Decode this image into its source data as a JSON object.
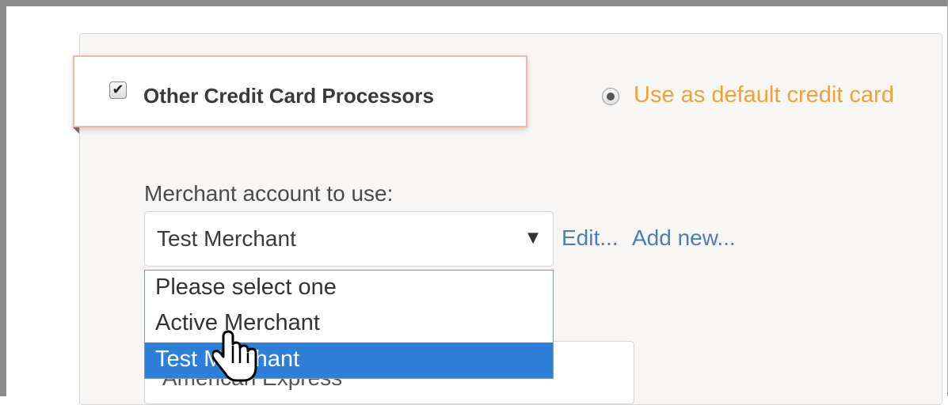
{
  "section": {
    "checkbox_checked": true,
    "checkbox_glyph": "✔",
    "title": "Other Credit Card Processors"
  },
  "default_option": {
    "selected": true,
    "label": "Use as default credit card",
    "color": "#f0a23a"
  },
  "merchant": {
    "label": "Merchant account to use:",
    "selected_value": "Test Merchant",
    "arrow_glyph": "▼",
    "edit_link": "Edit...",
    "add_link": "Add new...",
    "options": [
      "Please select one",
      "Active Merchant",
      "Test Merchant"
    ],
    "highlighted_index": 2,
    "highlight_color": "#2d7fd8"
  },
  "partially_hidden": {
    "text": "American Express"
  },
  "colors": {
    "link": "#4a7fb5",
    "tab_border": "#f2b99f"
  },
  "icons": {
    "cursor": "hand-pointer-icon",
    "checkbox": "checkmark-icon",
    "radio": "radio-dot-icon",
    "dropdown": "triangle-down-icon"
  }
}
